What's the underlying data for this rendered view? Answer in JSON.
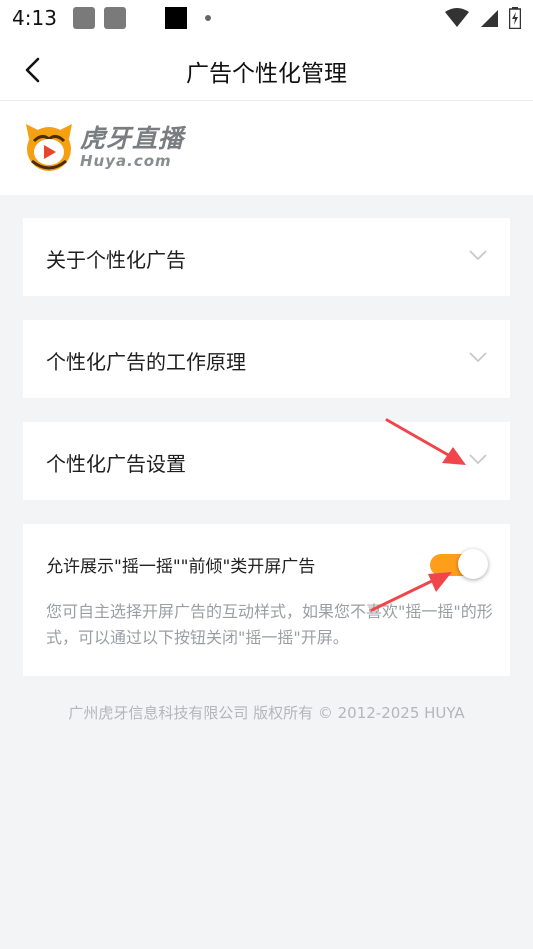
{
  "status_bar": {
    "time": "4:13"
  },
  "nav": {
    "title": "广告个性化管理",
    "back_icon": "chevron-left-icon"
  },
  "logo": {
    "text_cn": "虎牙直播",
    "text_en": "Huya.com"
  },
  "sections": [
    {
      "label": "关于个性化广告"
    },
    {
      "label": "个性化广告的工作原理"
    },
    {
      "label": "个性化广告设置"
    }
  ],
  "toggle_setting": {
    "label": "允许展示\"摇一摇\"\"前倾\"类开屏广告",
    "enabled": true,
    "description": "您可自主选择开屏广告的互动样式，如果您不喜欢\"摇一摇\"的形式，可以通过以下按钮关闭\"摇一摇\"开屏。"
  },
  "footer": {
    "copyright": "广州虎牙信息科技有限公司 版权所有 © 2012-2025 HUYA"
  },
  "colors": {
    "accent": "#ff9e1b",
    "annotation_arrow": "#f0464b"
  }
}
